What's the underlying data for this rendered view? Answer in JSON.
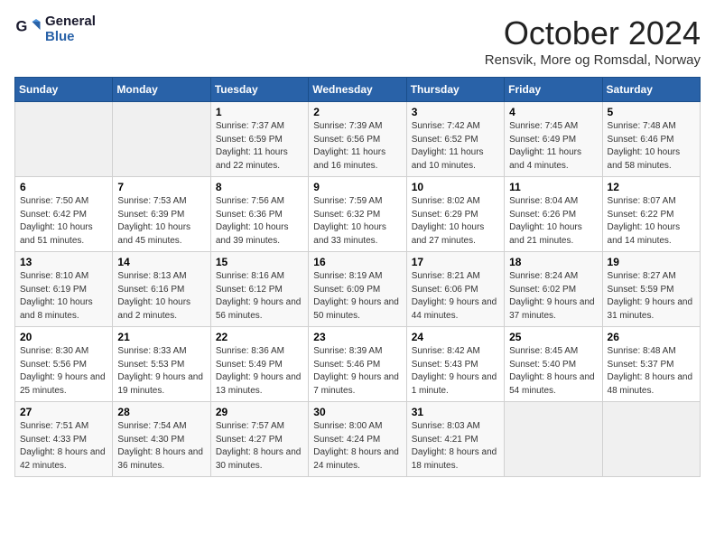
{
  "app": {
    "name": "GeneralBlue",
    "logo_line1": "General",
    "logo_line2": "Blue"
  },
  "calendar": {
    "month_title": "October 2024",
    "location": "Rensvik, More og Romsdal, Norway"
  },
  "headers": [
    "Sunday",
    "Monday",
    "Tuesday",
    "Wednesday",
    "Thursday",
    "Friday",
    "Saturday"
  ],
  "weeks": [
    [
      {
        "day": "",
        "sunrise": "",
        "sunset": "",
        "daylight": ""
      },
      {
        "day": "",
        "sunrise": "",
        "sunset": "",
        "daylight": ""
      },
      {
        "day": "1",
        "sunrise": "Sunrise: 7:37 AM",
        "sunset": "Sunset: 6:59 PM",
        "daylight": "Daylight: 11 hours and 22 minutes."
      },
      {
        "day": "2",
        "sunrise": "Sunrise: 7:39 AM",
        "sunset": "Sunset: 6:56 PM",
        "daylight": "Daylight: 11 hours and 16 minutes."
      },
      {
        "day": "3",
        "sunrise": "Sunrise: 7:42 AM",
        "sunset": "Sunset: 6:52 PM",
        "daylight": "Daylight: 11 hours and 10 minutes."
      },
      {
        "day": "4",
        "sunrise": "Sunrise: 7:45 AM",
        "sunset": "Sunset: 6:49 PM",
        "daylight": "Daylight: 11 hours and 4 minutes."
      },
      {
        "day": "5",
        "sunrise": "Sunrise: 7:48 AM",
        "sunset": "Sunset: 6:46 PM",
        "daylight": "Daylight: 10 hours and 58 minutes."
      }
    ],
    [
      {
        "day": "6",
        "sunrise": "Sunrise: 7:50 AM",
        "sunset": "Sunset: 6:42 PM",
        "daylight": "Daylight: 10 hours and 51 minutes."
      },
      {
        "day": "7",
        "sunrise": "Sunrise: 7:53 AM",
        "sunset": "Sunset: 6:39 PM",
        "daylight": "Daylight: 10 hours and 45 minutes."
      },
      {
        "day": "8",
        "sunrise": "Sunrise: 7:56 AM",
        "sunset": "Sunset: 6:36 PM",
        "daylight": "Daylight: 10 hours and 39 minutes."
      },
      {
        "day": "9",
        "sunrise": "Sunrise: 7:59 AM",
        "sunset": "Sunset: 6:32 PM",
        "daylight": "Daylight: 10 hours and 33 minutes."
      },
      {
        "day": "10",
        "sunrise": "Sunrise: 8:02 AM",
        "sunset": "Sunset: 6:29 PM",
        "daylight": "Daylight: 10 hours and 27 minutes."
      },
      {
        "day": "11",
        "sunrise": "Sunrise: 8:04 AM",
        "sunset": "Sunset: 6:26 PM",
        "daylight": "Daylight: 10 hours and 21 minutes."
      },
      {
        "day": "12",
        "sunrise": "Sunrise: 8:07 AM",
        "sunset": "Sunset: 6:22 PM",
        "daylight": "Daylight: 10 hours and 14 minutes."
      }
    ],
    [
      {
        "day": "13",
        "sunrise": "Sunrise: 8:10 AM",
        "sunset": "Sunset: 6:19 PM",
        "daylight": "Daylight: 10 hours and 8 minutes."
      },
      {
        "day": "14",
        "sunrise": "Sunrise: 8:13 AM",
        "sunset": "Sunset: 6:16 PM",
        "daylight": "Daylight: 10 hours and 2 minutes."
      },
      {
        "day": "15",
        "sunrise": "Sunrise: 8:16 AM",
        "sunset": "Sunset: 6:12 PM",
        "daylight": "Daylight: 9 hours and 56 minutes."
      },
      {
        "day": "16",
        "sunrise": "Sunrise: 8:19 AM",
        "sunset": "Sunset: 6:09 PM",
        "daylight": "Daylight: 9 hours and 50 minutes."
      },
      {
        "day": "17",
        "sunrise": "Sunrise: 8:21 AM",
        "sunset": "Sunset: 6:06 PM",
        "daylight": "Daylight: 9 hours and 44 minutes."
      },
      {
        "day": "18",
        "sunrise": "Sunrise: 8:24 AM",
        "sunset": "Sunset: 6:02 PM",
        "daylight": "Daylight: 9 hours and 37 minutes."
      },
      {
        "day": "19",
        "sunrise": "Sunrise: 8:27 AM",
        "sunset": "Sunset: 5:59 PM",
        "daylight": "Daylight: 9 hours and 31 minutes."
      }
    ],
    [
      {
        "day": "20",
        "sunrise": "Sunrise: 8:30 AM",
        "sunset": "Sunset: 5:56 PM",
        "daylight": "Daylight: 9 hours and 25 minutes."
      },
      {
        "day": "21",
        "sunrise": "Sunrise: 8:33 AM",
        "sunset": "Sunset: 5:53 PM",
        "daylight": "Daylight: 9 hours and 19 minutes."
      },
      {
        "day": "22",
        "sunrise": "Sunrise: 8:36 AM",
        "sunset": "Sunset: 5:49 PM",
        "daylight": "Daylight: 9 hours and 13 minutes."
      },
      {
        "day": "23",
        "sunrise": "Sunrise: 8:39 AM",
        "sunset": "Sunset: 5:46 PM",
        "daylight": "Daylight: 9 hours and 7 minutes."
      },
      {
        "day": "24",
        "sunrise": "Sunrise: 8:42 AM",
        "sunset": "Sunset: 5:43 PM",
        "daylight": "Daylight: 9 hours and 1 minute."
      },
      {
        "day": "25",
        "sunrise": "Sunrise: 8:45 AM",
        "sunset": "Sunset: 5:40 PM",
        "daylight": "Daylight: 8 hours and 54 minutes."
      },
      {
        "day": "26",
        "sunrise": "Sunrise: 8:48 AM",
        "sunset": "Sunset: 5:37 PM",
        "daylight": "Daylight: 8 hours and 48 minutes."
      }
    ],
    [
      {
        "day": "27",
        "sunrise": "Sunrise: 7:51 AM",
        "sunset": "Sunset: 4:33 PM",
        "daylight": "Daylight: 8 hours and 42 minutes."
      },
      {
        "day": "28",
        "sunrise": "Sunrise: 7:54 AM",
        "sunset": "Sunset: 4:30 PM",
        "daylight": "Daylight: 8 hours and 36 minutes."
      },
      {
        "day": "29",
        "sunrise": "Sunrise: 7:57 AM",
        "sunset": "Sunset: 4:27 PM",
        "daylight": "Daylight: 8 hours and 30 minutes."
      },
      {
        "day": "30",
        "sunrise": "Sunrise: 8:00 AM",
        "sunset": "Sunset: 4:24 PM",
        "daylight": "Daylight: 8 hours and 24 minutes."
      },
      {
        "day": "31",
        "sunrise": "Sunrise: 8:03 AM",
        "sunset": "Sunset: 4:21 PM",
        "daylight": "Daylight: 8 hours and 18 minutes."
      },
      {
        "day": "",
        "sunrise": "",
        "sunset": "",
        "daylight": ""
      },
      {
        "day": "",
        "sunrise": "",
        "sunset": "",
        "daylight": ""
      }
    ]
  ]
}
